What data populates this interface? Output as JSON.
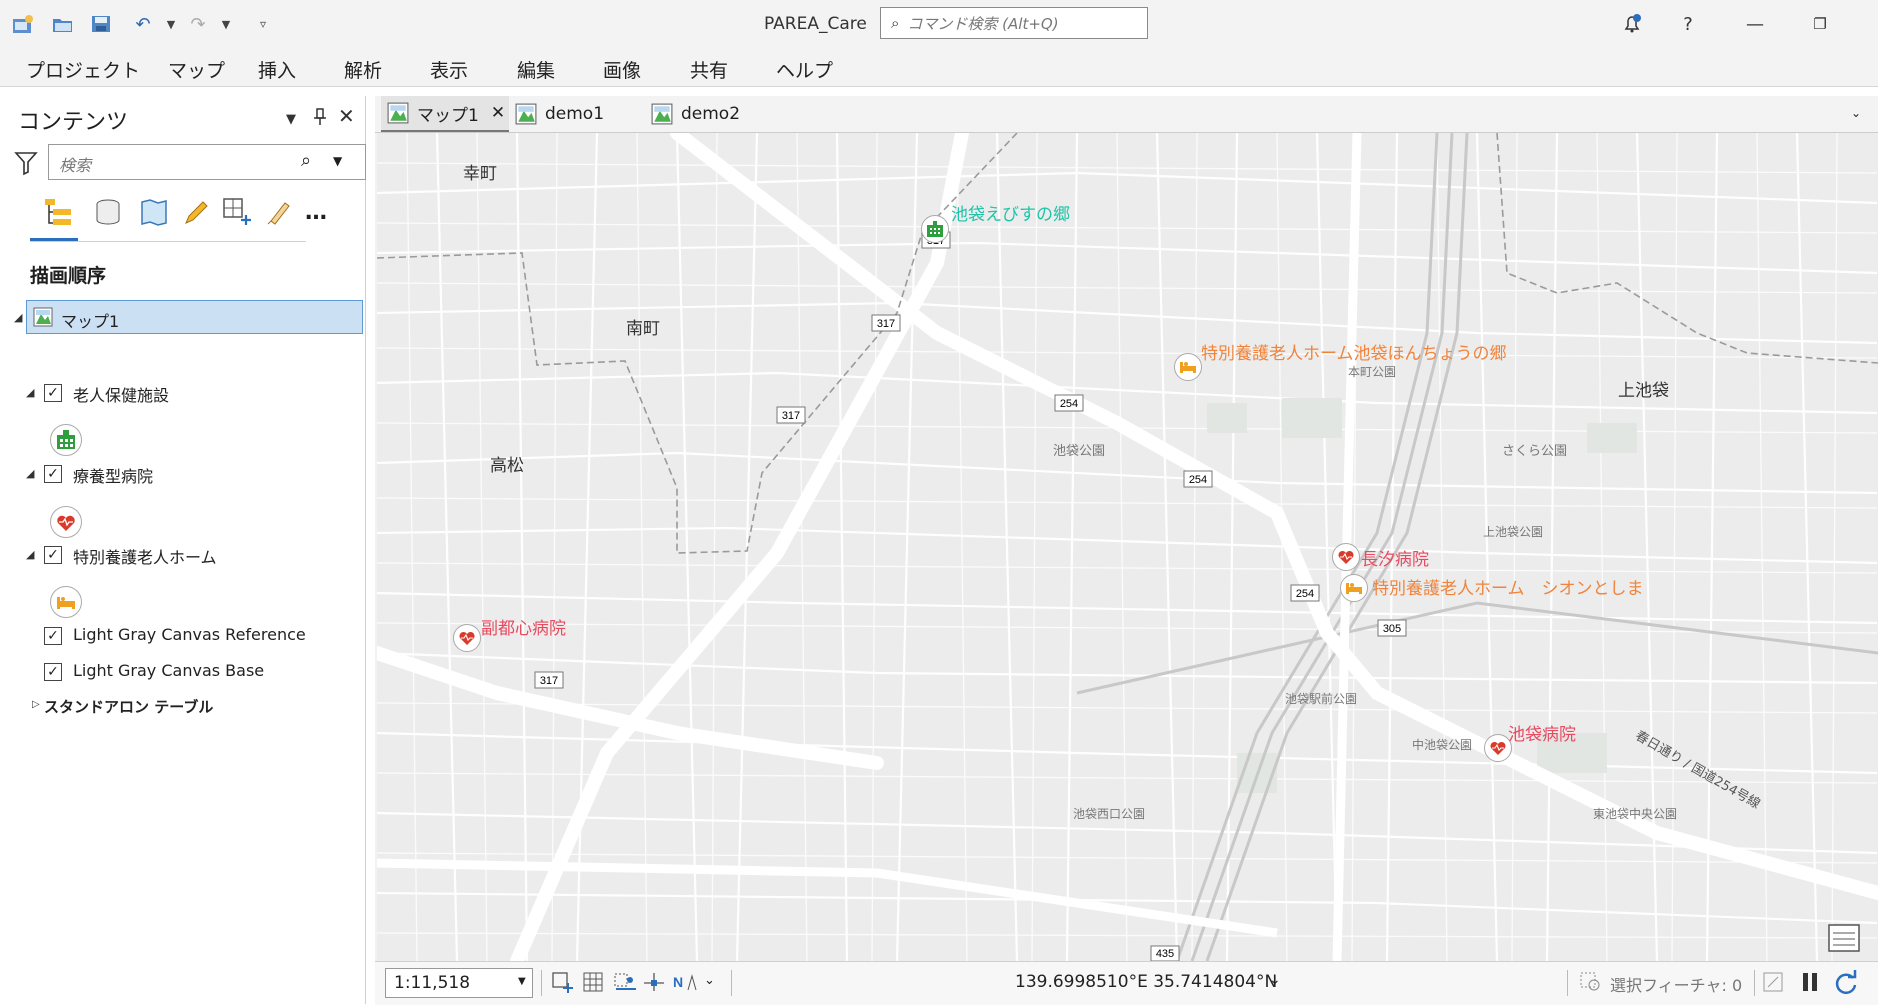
{
  "app": {
    "title": "PAREA_Care",
    "command_search_placeholder": "コマンド検索 (Alt+Q)",
    "help": "?"
  },
  "menu": [
    "プロジェクト",
    "マップ",
    "挿入",
    "解析",
    "表示",
    "編集",
    "画像",
    "共有",
    "ヘルプ"
  ],
  "contents": {
    "title": "コンテンツ",
    "search_placeholder": "検索",
    "section_title": "描画順序",
    "map_name": "マップ1",
    "layers": [
      {
        "name": "老人保健施設",
        "checked": true,
        "symbol": "nursing-facility-icon",
        "color": "#2e9e3f"
      },
      {
        "name": "療養型病院",
        "checked": true,
        "symbol": "hospital-heart-icon",
        "color": "#d93a2b"
      },
      {
        "name": "特別養護老人ホーム",
        "checked": true,
        "symbol": "bed-icon",
        "color": "#f0a020"
      },
      {
        "name": "Light Gray Canvas Reference",
        "checked": true
      },
      {
        "name": "Light Gray Canvas Base",
        "checked": true
      }
    ],
    "standalone": "スタンドアロン テーブル"
  },
  "tabs": [
    {
      "label": "マップ1",
      "active": true
    },
    {
      "label": "demo1",
      "active": false
    },
    {
      "label": "demo2",
      "active": false
    }
  ],
  "map": {
    "place_labels": [
      "幸町",
      "南町",
      "高松",
      "上池袋"
    ],
    "park_labels": [
      "本町公園",
      "池袋公園",
      "さくら公園",
      "上池袋公園",
      "池袋駅前公園",
      "中池袋公園",
      "池袋西口公園",
      "東池袋中央公園"
    ],
    "road_shields": [
      "317",
      "317",
      "317",
      "317",
      "254",
      "254",
      "254",
      "305",
      "435"
    ],
    "road_name": "春日通り / 国道254号線",
    "facilities": [
      {
        "name": "池袋えびすの郷",
        "type": "nursing",
        "color": "#1fc4a8"
      },
      {
        "name": "特別養護老人ホーム池袋ほんちょうの郷",
        "type": "special-home",
        "color": "#f0843c"
      },
      {
        "name": "長汐病院",
        "type": "hospital",
        "color": "#e84a5f"
      },
      {
        "name": "特別養護老人ホーム　シオンとしま",
        "type": "special-home",
        "color": "#f0843c"
      },
      {
        "name": "副都心病院",
        "type": "hospital",
        "color": "#e84a5f"
      },
      {
        "name": "池袋病院",
        "type": "hospital",
        "color": "#e84a5f"
      }
    ]
  },
  "status": {
    "scale": "1:11,518",
    "coordinates": "139.6998510°E 35.7414804°N",
    "selected_features": "選択フィーチャ: 0"
  }
}
